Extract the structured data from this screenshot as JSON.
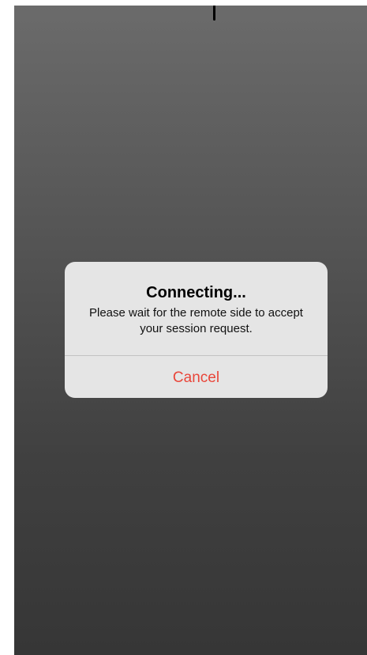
{
  "alert": {
    "title": "Connecting...",
    "message": "Please wait for the remote side to accept your session request.",
    "cancel_label": "Cancel"
  },
  "colors": {
    "cancel_text": "#e9463a",
    "alert_background": "#e5e5e5",
    "backdrop_top": "#6b6b6b",
    "backdrop_bottom": "#363636"
  }
}
